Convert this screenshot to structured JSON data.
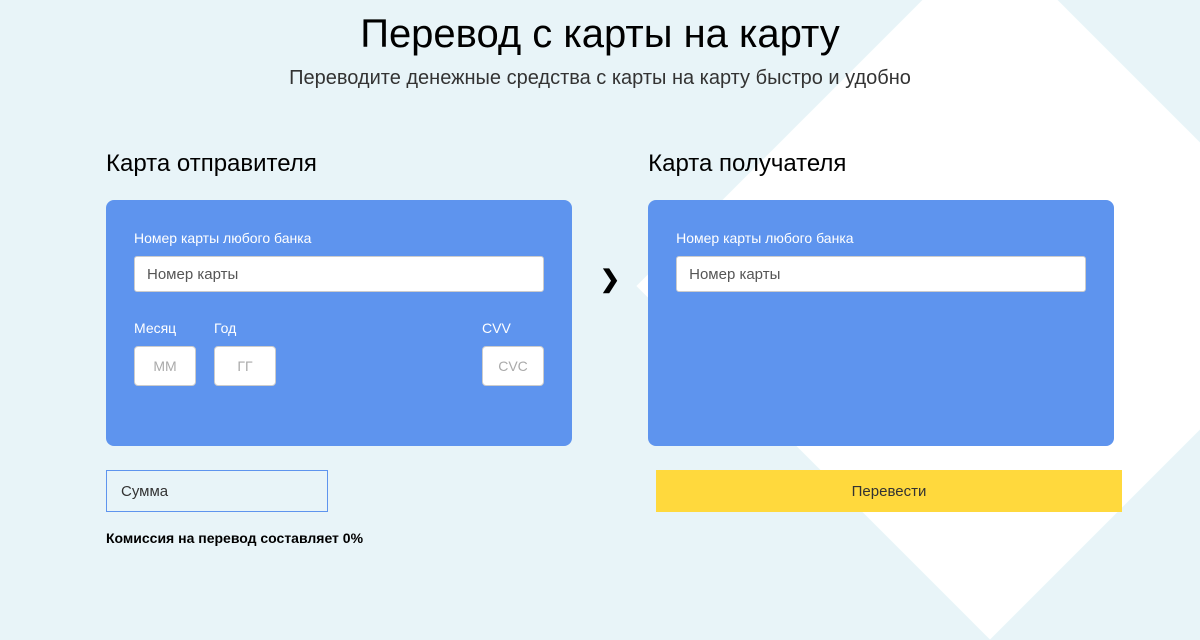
{
  "page": {
    "title": "Перевод с карты на карту",
    "subtitle": "Переводите денежные средства с карты на карту быстро и удобно"
  },
  "sender": {
    "heading": "Карта отправителя",
    "card_number_label": "Номер карты любого банка",
    "card_number_placeholder": "Номер карты",
    "month_label": "Месяц",
    "month_placeholder": "ММ",
    "year_label": "Год",
    "year_placeholder": "ГГ",
    "cvv_label": "CVV",
    "cvv_placeholder": "CVC"
  },
  "recipient": {
    "heading": "Карта получателя",
    "card_number_label": "Номер карты любого банка",
    "card_number_placeholder": "Номер карты"
  },
  "transfer": {
    "amount_placeholder": "Сумма",
    "commission_text": "Комиссия на перевод составляет 0%",
    "button_label": "Перевести"
  }
}
